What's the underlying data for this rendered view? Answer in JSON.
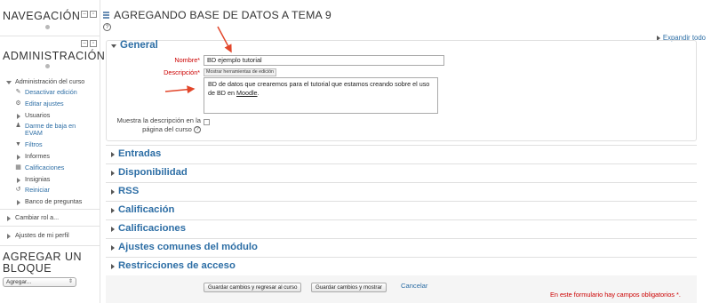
{
  "sidebar": {
    "navigation_title": "NAVEGACIÓN",
    "admin_title": "ADMINISTRACIÓN",
    "course_admin_label": "Administración del curso",
    "items": [
      {
        "label": "Desactivar edición",
        "icon": "pencil-icon"
      },
      {
        "label": "Editar ajustes",
        "icon": "gear-icon"
      },
      {
        "label": "Usuarios",
        "icon": "triangle-right-icon"
      },
      {
        "label": "Darme de baja en EVAM",
        "icon": "person-icon"
      },
      {
        "label": "Filtros",
        "icon": "filter-icon"
      },
      {
        "label": "Informes",
        "icon": "triangle-right-icon"
      },
      {
        "label": "Calificaciones",
        "icon": "grades-table-icon"
      },
      {
        "label": "Insignias",
        "icon": "triangle-right-icon"
      },
      {
        "label": "Reiniciar",
        "icon": "reset-icon"
      },
      {
        "label": "Banco de preguntas",
        "icon": "triangle-right-icon"
      }
    ],
    "switch_role": "Cambiar rol a...",
    "profile_settings": "Ajustes de mi perfil",
    "add_block_title": "AGREGAR UN BLOQUE",
    "add_block_select": "Agregar..."
  },
  "main": {
    "page_title": "AGREGANDO BASE DE DATOS A TEMA 9",
    "expand_all": "Expandir todo",
    "general_legend": "General",
    "nombre_label": "Nombre",
    "nombre_value": "BD ejemplo tutorial",
    "descripcion_label": "Descripción",
    "toolbar_button": "Mostrar herramientas de edición",
    "description_text": "BD de datos que crearemos para el tutorial que estamos creando sobre el uso de BD en",
    "description_link": "Moodle",
    "description_end": ".",
    "show_desc_label": "Muestra la descripción en la página del curso",
    "sections": [
      "Entradas",
      "Disponibilidad",
      "RSS",
      "Calificación",
      "Calificaciones",
      "Ajustes comunes del módulo",
      "Restricciones de acceso"
    ],
    "save_return_button": "Guardar cambios y regresar al curso",
    "save_show_button": "Guardar cambios y mostrar",
    "cancel_link": "Cancelar",
    "required_note": "En este formulario hay campos obligatorios",
    "required_mark": "*"
  },
  "colors": {
    "link_blue": "#2d6ea5",
    "required_red": "#cc0000",
    "annotation_arrow": "#e2462a"
  }
}
